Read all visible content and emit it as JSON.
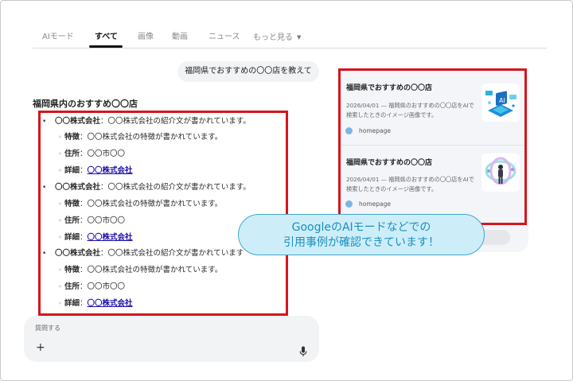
{
  "tabs": [
    {
      "label": "AIモード"
    },
    {
      "label": "すべて"
    },
    {
      "label": "画像"
    },
    {
      "label": "動画"
    },
    {
      "label": "ニュース"
    },
    {
      "label": "もっと見る"
    }
  ],
  "query": "福岡県でおすすめの〇〇店を教えて",
  "answer": {
    "heading": "福岡県内のおすすめ〇〇店",
    "items": [
      {
        "company": "〇〇株式会社",
        "intro": "：〇〇株式会社の紹介文が書かれています。",
        "feature_label": "特徴",
        "feature_text": "：〇〇株式会社の特徴が書かれています。",
        "address_label": "住所",
        "address_text": "：〇〇市〇〇",
        "detail_label": "詳細",
        "detail_sep": "：",
        "detail_link": "〇〇株式会社"
      },
      {
        "company": "〇〇株式会社",
        "intro": "：〇〇株式会社の紹介文が書かれています。",
        "feature_label": "特徴",
        "feature_text": "：〇〇株式会社の特徴が書かれています。",
        "address_label": "住所",
        "address_text": "：〇〇市〇〇",
        "detail_label": "詳細",
        "detail_sep": "：",
        "detail_link": "〇〇株式会社"
      },
      {
        "company": "〇〇株式会社",
        "intro": "：〇〇株式会社の紹介文が書かれています",
        "feature_label": "特徴",
        "feature_text": "：〇〇株式会社の特徴が書かれています。",
        "address_label": "住所",
        "address_text": "：〇〇市〇〇",
        "detail_label": "詳細",
        "detail_sep": "：",
        "detail_link": "〇〇株式会社"
      }
    ]
  },
  "input": {
    "placeholder": "質問する",
    "plus_icon": "plus-icon",
    "mic_icon": "mic-icon"
  },
  "sources": [
    {
      "title": "福岡県でおすすめの〇〇店",
      "desc_line1": "2026/04/01 — 福岡県のおすすめの〇〇店をAIで",
      "desc_line2": "検索したときのイメージ画像です。",
      "site": "homepage",
      "thumbnail_icon": "ai-laptop-illustration"
    },
    {
      "title": "福岡県でおすすめの〇〇店",
      "desc_line1": "2026/04/01 — 福岡県のおすすめの〇〇店をAIで",
      "desc_line2": "検索したときのイメージ画像です。",
      "site": "homepage",
      "thumbnail_icon": "person-ai-illustration"
    }
  ],
  "callout": {
    "line1": "GoogleのAIモードなどでの",
    "line2": "引用事例が確認できています！"
  },
  "colors": {
    "highlight_border": "#d7151b",
    "callout_fill": "#cdeef8",
    "callout_text": "#1a8fc1",
    "link": "#1a0dab"
  }
}
